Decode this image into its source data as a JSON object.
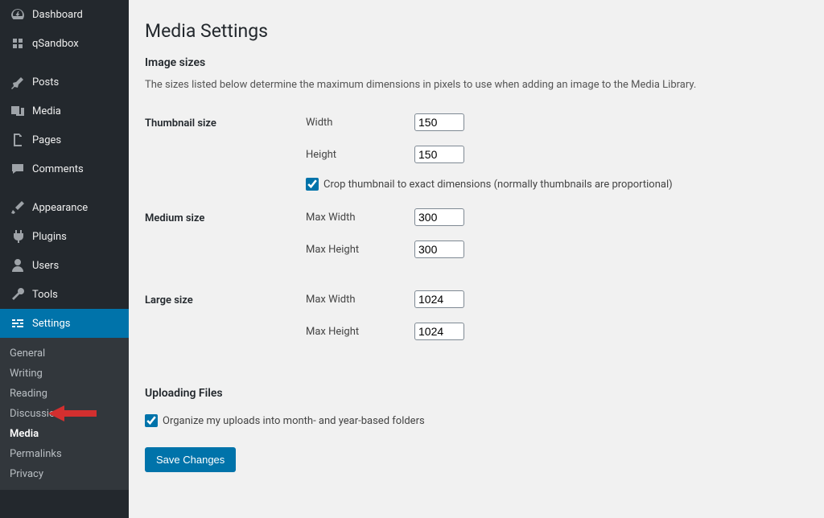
{
  "sidebar": {
    "items": [
      {
        "label": "Dashboard"
      },
      {
        "label": "qSandbox"
      },
      {
        "label": "Posts"
      },
      {
        "label": "Media"
      },
      {
        "label": "Pages"
      },
      {
        "label": "Comments"
      },
      {
        "label": "Appearance"
      },
      {
        "label": "Plugins"
      },
      {
        "label": "Users"
      },
      {
        "label": "Tools"
      },
      {
        "label": "Settings"
      }
    ],
    "submenu": [
      {
        "label": "General"
      },
      {
        "label": "Writing"
      },
      {
        "label": "Reading"
      },
      {
        "label": "Discussion"
      },
      {
        "label": "Media"
      },
      {
        "label": "Permalinks"
      },
      {
        "label": "Privacy"
      }
    ]
  },
  "page": {
    "title": "Media Settings",
    "image_sizes": {
      "heading": "Image sizes",
      "description": "The sizes listed below determine the maximum dimensions in pixels to use when adding an image to the Media Library.",
      "thumbnail": {
        "row_label": "Thumbnail size",
        "width_label": "Width",
        "width_value": 150,
        "height_label": "Height",
        "height_value": 150,
        "crop_label": "Crop thumbnail to exact dimensions (normally thumbnails are proportional)",
        "crop_checked": true
      },
      "medium": {
        "row_label": "Medium size",
        "max_width_label": "Max Width",
        "max_width_value": 300,
        "max_height_label": "Max Height",
        "max_height_value": 300
      },
      "large": {
        "row_label": "Large size",
        "max_width_label": "Max Width",
        "max_width_value": 1024,
        "max_height_label": "Max Height",
        "max_height_value": 1024
      }
    },
    "uploading": {
      "heading": "Uploading Files",
      "organize_label": "Organize my uploads into month- and year-based folders",
      "organize_checked": true
    },
    "save_label": "Save Changes"
  }
}
